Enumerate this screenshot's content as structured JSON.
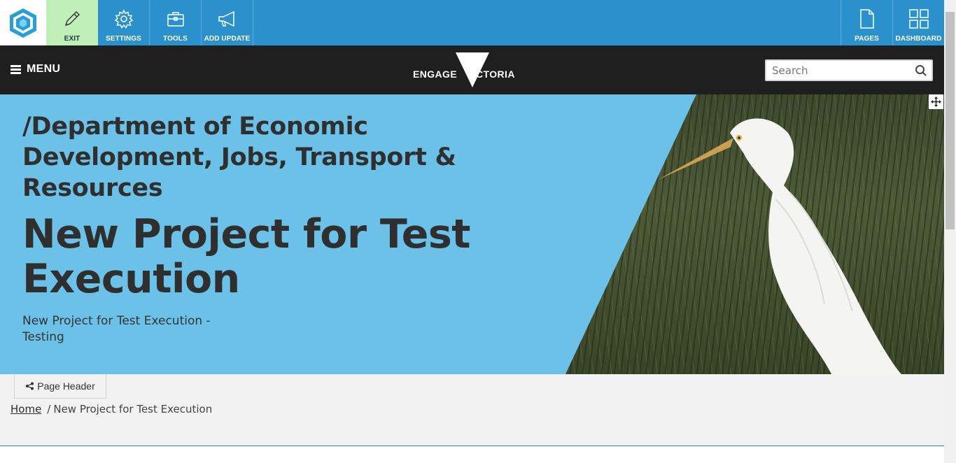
{
  "admin_bar": {
    "buttons_left": [
      {
        "label": "EXIT",
        "icon": "pencil-icon"
      },
      {
        "label": "SETTINGS",
        "icon": "gear-icon"
      },
      {
        "label": "TOOLS",
        "icon": "toolbox-icon"
      },
      {
        "label": "ADD UPDATE",
        "icon": "megaphone-icon"
      }
    ],
    "buttons_right": [
      {
        "label": "PAGES",
        "icon": "page-icon"
      },
      {
        "label": "DASHBOARD",
        "icon": "grid-icon"
      }
    ],
    "colors": {
      "bar": "#2b91cc",
      "exit_bg": "#bff0b8"
    }
  },
  "site_header": {
    "menu_label": "MENU",
    "logo": {
      "left": "ENGAGE",
      "right": "VICTORIA"
    },
    "search": {
      "placeholder": "Search"
    }
  },
  "hero": {
    "organisation": "/Department of Economic Development, Jobs, Transport & Resources",
    "title": "New Project for Test Execution",
    "description": "New Project for Test Execution - Testing",
    "background_color": "#6cc1e8"
  },
  "page_header_tab": {
    "label": "Page Header"
  },
  "breadcrumb": {
    "home": "Home",
    "separator": "/",
    "current": "New Project for Test Execution"
  }
}
